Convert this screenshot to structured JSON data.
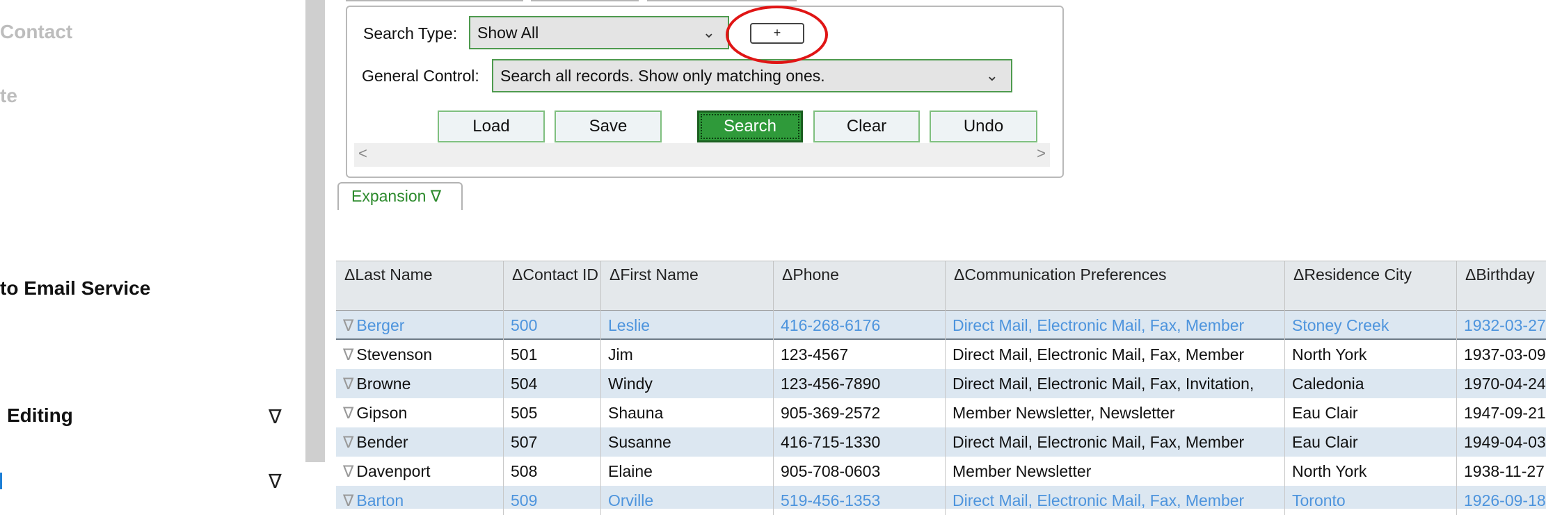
{
  "sidebar": {
    "items": [
      {
        "label": "Contact"
      },
      {
        "label": "te"
      },
      {
        "label": "to Email Service"
      },
      {
        "label": "Editing",
        "arrow": "∇"
      },
      {
        "label": "",
        "arrow": "∇"
      }
    ]
  },
  "search_panel": {
    "search_type_label": "Search Type:",
    "search_type_value": "Show All",
    "plus_label": "+",
    "general_control_label": "General Control:",
    "general_control_value": "Search all records. Show only matching ones.",
    "buttons": {
      "load": "Load",
      "save": "Save",
      "search": "Search",
      "clear": "Clear",
      "undo": "Undo"
    },
    "scroll_left": "<",
    "scroll_right": ">"
  },
  "expansion": {
    "label": "Expansion ∇"
  },
  "table": {
    "sort_icon": "Δ",
    "row_icon": "∇",
    "columns": [
      {
        "label": "Last Name"
      },
      {
        "label": "Contact ID"
      },
      {
        "label": "First Name"
      },
      {
        "label": "Phone"
      },
      {
        "label": "Communication Preferences"
      },
      {
        "label": "Residence City"
      },
      {
        "label": "Birthday"
      }
    ],
    "rows": [
      {
        "last": "Berger",
        "id": "500",
        "first": "Leslie",
        "phone": "416-268-6176",
        "prefs": "Direct Mail, Electronic Mail, Fax, Member",
        "city": "Stoney Creek",
        "birthday": "1932-03-27"
      },
      {
        "last": "Stevenson",
        "id": "501",
        "first": "Jim",
        "phone": "123-4567",
        "prefs": "Direct Mail, Electronic Mail, Fax, Member",
        "city": "North York",
        "birthday": "1937-03-09"
      },
      {
        "last": "Browne",
        "id": "504",
        "first": "Windy",
        "phone": "123-456-7890",
        "prefs": "Direct Mail, Electronic Mail, Fax, Invitation,",
        "city": "Caledonia",
        "birthday": "1970-04-24"
      },
      {
        "last": "Gipson",
        "id": "505",
        "first": "Shauna",
        "phone": "905-369-2572",
        "prefs": "Member Newsletter, Newsletter",
        "city": "Eau Clair",
        "birthday": "1947-09-21"
      },
      {
        "last": "Bender",
        "id": "507",
        "first": "Susanne",
        "phone": "416-715-1330",
        "prefs": "Direct Mail, Electronic Mail, Fax, Member",
        "city": "Eau Clair",
        "birthday": "1949-04-03"
      },
      {
        "last": "Davenport",
        "id": "508",
        "first": "Elaine",
        "phone": "905-708-0603",
        "prefs": "Member Newsletter",
        "city": "North York",
        "birthday": "1938-11-27"
      },
      {
        "last": "Barton",
        "id": "509",
        "first": "Orville",
        "phone": "519-456-1353",
        "prefs": "Direct Mail, Electronic Mail, Fax, Member",
        "city": "Toronto",
        "birthday": "1926-09-18"
      }
    ]
  },
  "colors": {
    "accent_green": "#2f9a3a",
    "link_blue": "#4d94dd",
    "highlight_red": "#e01515",
    "row_stripe": "#dce7f1"
  }
}
